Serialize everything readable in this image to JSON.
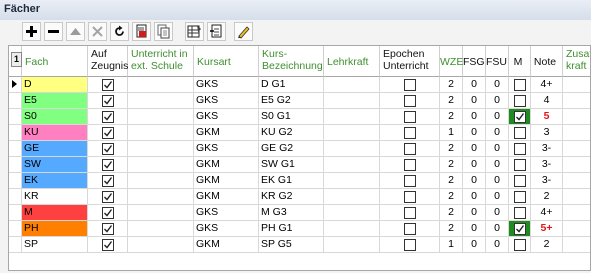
{
  "window_title": "Fächer",
  "toolbar": {
    "buttons": [
      {
        "name": "add-button",
        "icon": "plus-icon"
      },
      {
        "name": "remove-button",
        "icon": "minus-icon"
      },
      {
        "name": "move-up-button",
        "icon": "triangle-up-icon"
      },
      {
        "name": "delete-button",
        "icon": "x-icon"
      },
      {
        "name": "refresh-button",
        "icon": "refresh-icon"
      },
      {
        "name": "export-button",
        "icon": "document-red-icon"
      },
      {
        "name": "copy-button",
        "icon": "document-copy-icon"
      },
      {
        "name": "table-button",
        "icon": "table-edit-icon"
      },
      {
        "name": "import-button",
        "icon": "document-arrow-icon"
      },
      {
        "name": "edit-button",
        "icon": "pencil-icon"
      }
    ]
  },
  "row_selector": "1",
  "columns": [
    {
      "key": "fach",
      "label": "Fach",
      "color": "green"
    },
    {
      "key": "zeugnis",
      "label": "Auf\nZeugnis",
      "color": "black"
    },
    {
      "key": "ext",
      "label": "Unterricht in\next. Schule",
      "color": "green"
    },
    {
      "key": "kursart",
      "label": "Kursart",
      "color": "green"
    },
    {
      "key": "bez",
      "label": "Kurs-\nBezeichnung",
      "color": "green"
    },
    {
      "key": "lehrkraft",
      "label": "Lehrkraft",
      "color": "green"
    },
    {
      "key": "epochen",
      "label": "Epochen\nUnterricht",
      "color": "black"
    },
    {
      "key": "wze",
      "label": "WZE",
      "color": "green"
    },
    {
      "key": "fsg",
      "label": "FSG",
      "color": "black"
    },
    {
      "key": "fsu",
      "label": "FSU",
      "color": "black"
    },
    {
      "key": "m",
      "label": "M",
      "color": "black"
    },
    {
      "key": "note",
      "label": "Note",
      "color": "black"
    },
    {
      "key": "zusatz",
      "label": "Zusat\nkraft",
      "color": "green"
    }
  ],
  "rows": [
    {
      "fach": "D",
      "bg": "#ffff80",
      "zeugnis": true,
      "kursart": "GKS",
      "bez": "D  G1",
      "epochen": false,
      "wze": "2",
      "fsg": "0",
      "fsu": "0",
      "m": "none",
      "note": "4+",
      "note_red": false
    },
    {
      "fach": "E5",
      "bg": "#80ff80",
      "zeugnis": true,
      "kursart": "GKS",
      "bez": "E5 G2",
      "epochen": false,
      "wze": "2",
      "fsg": "0",
      "fsu": "0",
      "m": "none",
      "note": "4",
      "note_red": false
    },
    {
      "fach": "S0",
      "bg": "#80ff80",
      "zeugnis": true,
      "kursart": "GKS",
      "bez": "S0 G1",
      "epochen": false,
      "wze": "2",
      "fsg": "0",
      "fsu": "0",
      "m": "checked-green",
      "note": "5",
      "note_red": true
    },
    {
      "fach": "KU",
      "bg": "#ff80c0",
      "zeugnis": true,
      "kursart": "GKM",
      "bez": "KU G2",
      "epochen": false,
      "wze": "1",
      "fsg": "0",
      "fsu": "0",
      "m": "none",
      "note": "3",
      "note_red": false
    },
    {
      "fach": "GE",
      "bg": "#55aaff",
      "zeugnis": true,
      "kursart": "GKS",
      "bez": "GE G2",
      "epochen": false,
      "wze": "2",
      "fsg": "0",
      "fsu": "0",
      "m": "none",
      "note": "3-",
      "note_red": false
    },
    {
      "fach": "SW",
      "bg": "#55aaff",
      "zeugnis": true,
      "kursart": "GKM",
      "bez": "SW G1",
      "epochen": false,
      "wze": "2",
      "fsg": "0",
      "fsu": "0",
      "m": "none",
      "note": "3-",
      "note_red": false
    },
    {
      "fach": "EK",
      "bg": "#55aaff",
      "zeugnis": true,
      "kursart": "GKM",
      "bez": "EK G1",
      "epochen": false,
      "wze": "2",
      "fsg": "0",
      "fsu": "0",
      "m": "none",
      "note": "3-",
      "note_red": false
    },
    {
      "fach": "KR",
      "bg": "#ffffff",
      "zeugnis": true,
      "kursart": "GKM",
      "bez": "KR G2",
      "epochen": false,
      "wze": "2",
      "fsg": "0",
      "fsu": "0",
      "m": "none",
      "note": "2",
      "note_red": false
    },
    {
      "fach": "M",
      "bg": "#ff4040",
      "zeugnis": true,
      "kursart": "GKS",
      "bez": "M  G3",
      "epochen": false,
      "wze": "2",
      "fsg": "0",
      "fsu": "0",
      "m": "none",
      "note": "4+",
      "note_red": false
    },
    {
      "fach": "PH",
      "bg": "#ff8000",
      "zeugnis": true,
      "kursart": "GKS",
      "bez": "PH G1",
      "epochen": false,
      "wze": "2",
      "fsg": "0",
      "fsu": "0",
      "m": "checked-green",
      "note": "5+",
      "note_red": true
    },
    {
      "fach": "SP",
      "bg": "#ffffff",
      "zeugnis": true,
      "kursart": "GKM",
      "bez": "SP G5",
      "epochen": false,
      "wze": "1",
      "fsg": "0",
      "fsu": "0",
      "m": "none",
      "note": "2",
      "note_red": false
    }
  ]
}
